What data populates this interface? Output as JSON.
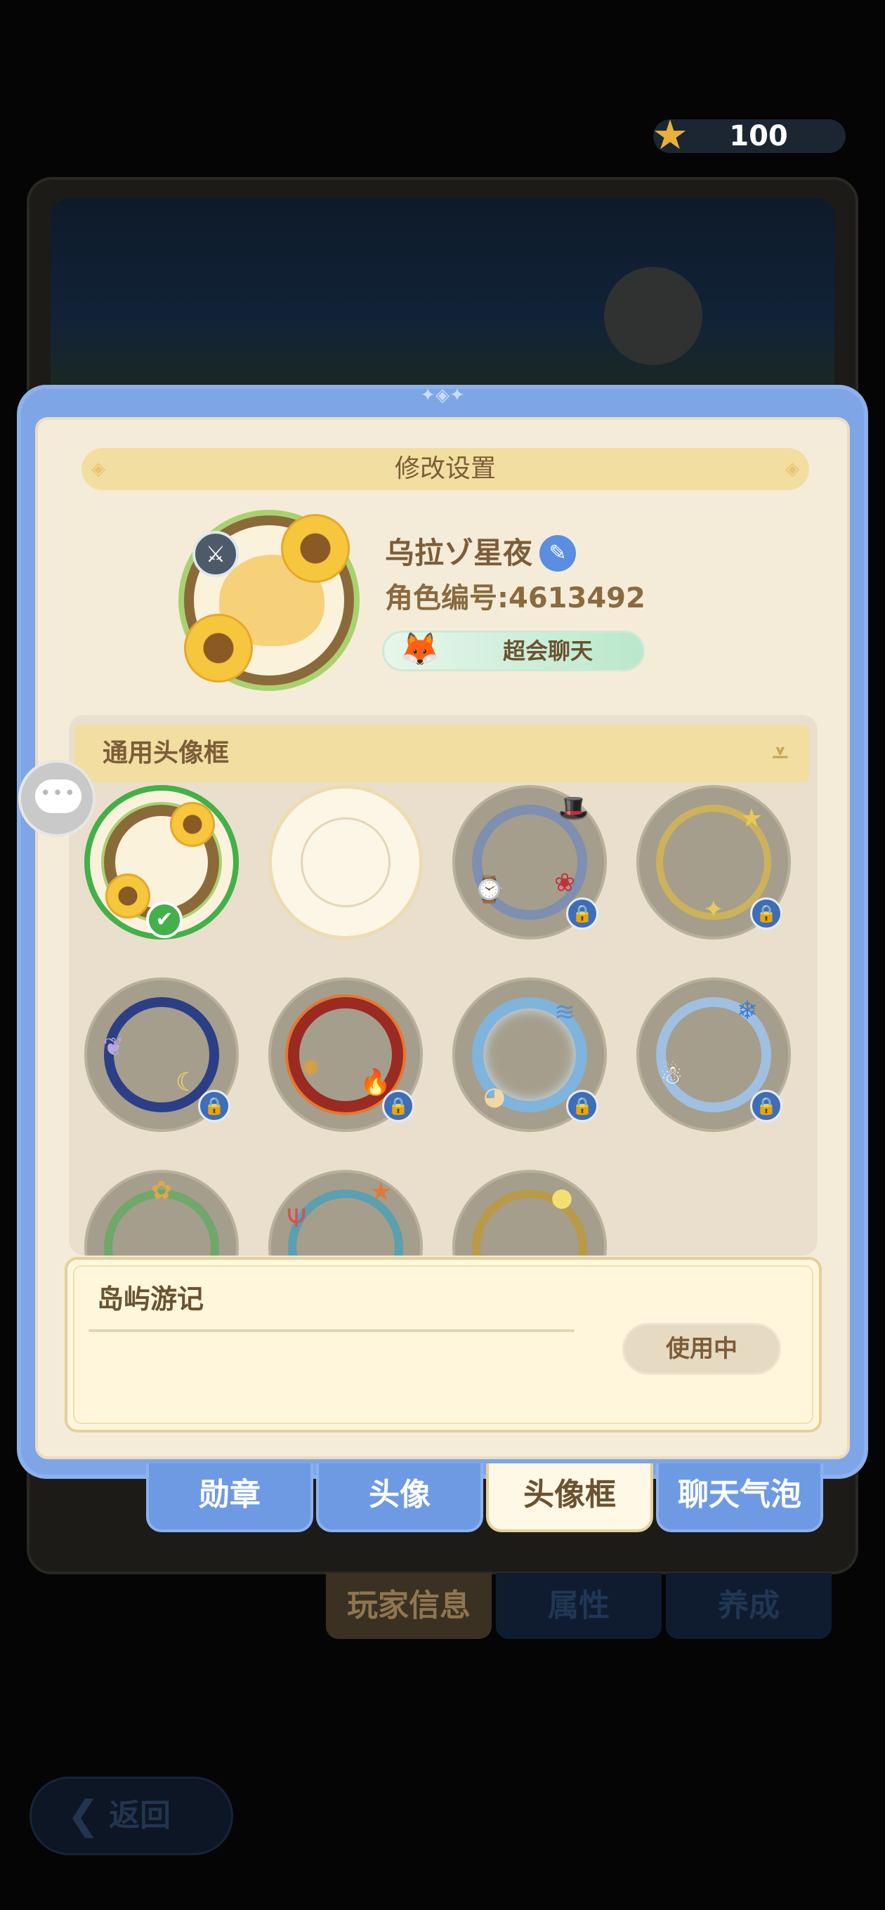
{
  "currency": {
    "value": "100",
    "icon": "star-coin-icon",
    "color": "#e8b13a"
  },
  "modal": {
    "title": "修改设置",
    "player": {
      "name": "乌拉ゾ星夜",
      "id_text": "角色编号:4613492",
      "title_tag": "超会聊天"
    },
    "frames_category": "通用头像框",
    "frames": [
      {
        "name": "sunflower-frame",
        "selected": true,
        "locked": false
      },
      {
        "name": "empty-frame",
        "selected": false,
        "locked": false
      },
      {
        "name": "pocket-watch-frame",
        "selected": false,
        "locked": true
      },
      {
        "name": "golden-star-frame",
        "selected": false,
        "locked": true
      },
      {
        "name": "starry-night-frame",
        "selected": false,
        "locked": true
      },
      {
        "name": "flame-frame",
        "selected": false,
        "locked": true
      },
      {
        "name": "ocean-wave-frame",
        "selected": false,
        "locked": true
      },
      {
        "name": "snowman-frame",
        "selected": false,
        "locked": true
      },
      {
        "name": "flower-vine-frame",
        "selected": false,
        "locked": false
      },
      {
        "name": "coral-frame",
        "selected": false,
        "locked": false
      },
      {
        "name": "golden-vine-frame",
        "selected": false,
        "locked": false
      }
    ],
    "selected_frame": {
      "name": "岛屿游记",
      "button_label": "使用中"
    }
  },
  "tabs": [
    {
      "label": "勋章",
      "active": false
    },
    {
      "label": "头像",
      "active": false
    },
    {
      "label": "头像框",
      "active": true
    },
    {
      "label": "聊天气泡",
      "active": false
    }
  ],
  "bottom_tabs": [
    {
      "label": "玩家信息",
      "active": true
    },
    {
      "label": "属性",
      "active": false
    },
    {
      "label": "养成",
      "active": false
    }
  ],
  "back_button": {
    "label": "返回"
  },
  "colors": {
    "modal_blue": "#7ea6e6",
    "panel_cream": "#f4ecd9",
    "header_gold": "#f2dea0",
    "selected_green": "#43b04a",
    "lock_blue": "#3f6db8"
  }
}
